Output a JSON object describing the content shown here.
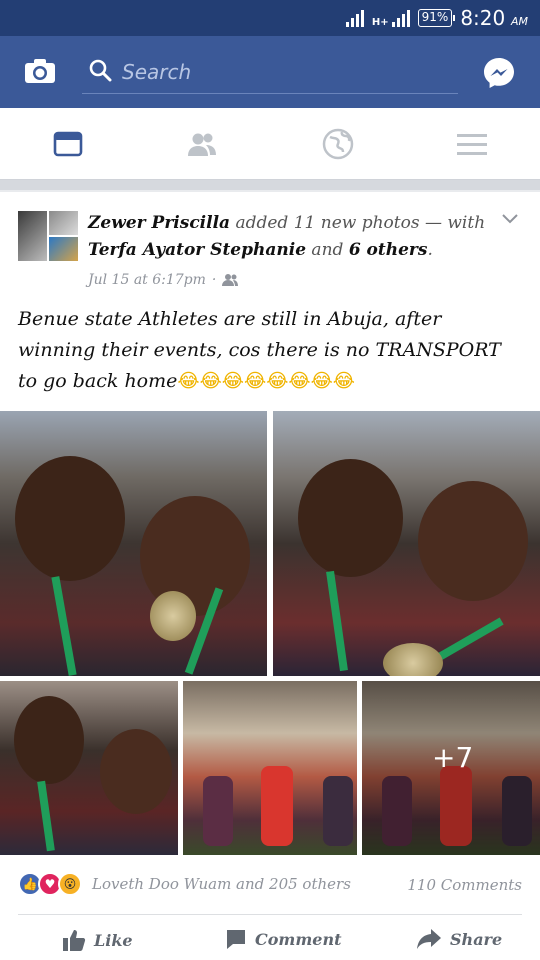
{
  "status_bar": {
    "network": "H+",
    "battery": "91%",
    "time": "8:20",
    "time_suffix": "AM"
  },
  "app_bar": {
    "search_placeholder": "Search",
    "icons": [
      "camera-icon",
      "search-icon",
      "messenger-icon"
    ]
  },
  "tabs": [
    {
      "name": "news-feed",
      "icon": "news-feed-icon",
      "active": true
    },
    {
      "name": "friends",
      "icon": "friends-icon",
      "active": false
    },
    {
      "name": "notifications",
      "icon": "globe-icon",
      "active": false
    },
    {
      "name": "menu",
      "icon": "hamburger-icon",
      "active": false
    }
  ],
  "post": {
    "author": "Zewer Priscilla",
    "action": " added 11 new photos — with ",
    "tagged": "Terfa Ayator Stephanie",
    "and": " and ",
    "others": "6 others",
    "period": ".",
    "timestamp": "Jul 15 at 6:17pm",
    "separator": "·",
    "audience": "friends-icon",
    "text": "Benue state Athletes are still in Abuja, after winning their events, cos there is no TRANSPORT to go back home",
    "emojis": "😂😂😂😂😂😂😂😂",
    "more_photos": "+7",
    "reactions_text": "Loveth Doo Wuam and 205 others",
    "comments": "110 Comments",
    "like_label": "Like",
    "comment_label": "Comment",
    "share_label": "Share"
  },
  "colors": {
    "status_bar": "#233e74",
    "app_bar": "#3b5998",
    "active_tab": "#3b5998",
    "inactive_tab": "#bec3c9"
  }
}
